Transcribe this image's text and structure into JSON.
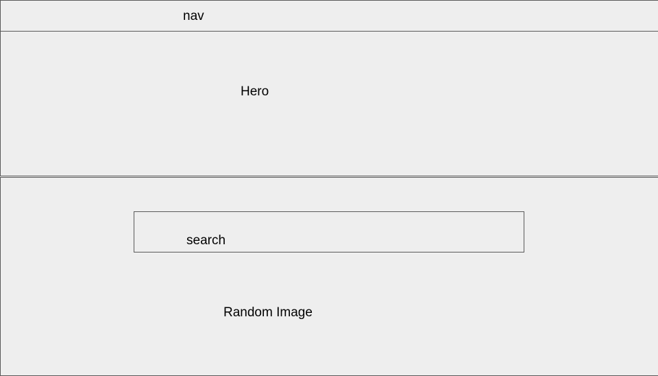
{
  "nav": {
    "label": "nav"
  },
  "hero": {
    "label": "Hero"
  },
  "search": {
    "label": "search"
  },
  "random_image": {
    "label": "Random Image"
  },
  "colors": {
    "background": "#eeeeee",
    "border": "#595959",
    "text": "#000000"
  }
}
